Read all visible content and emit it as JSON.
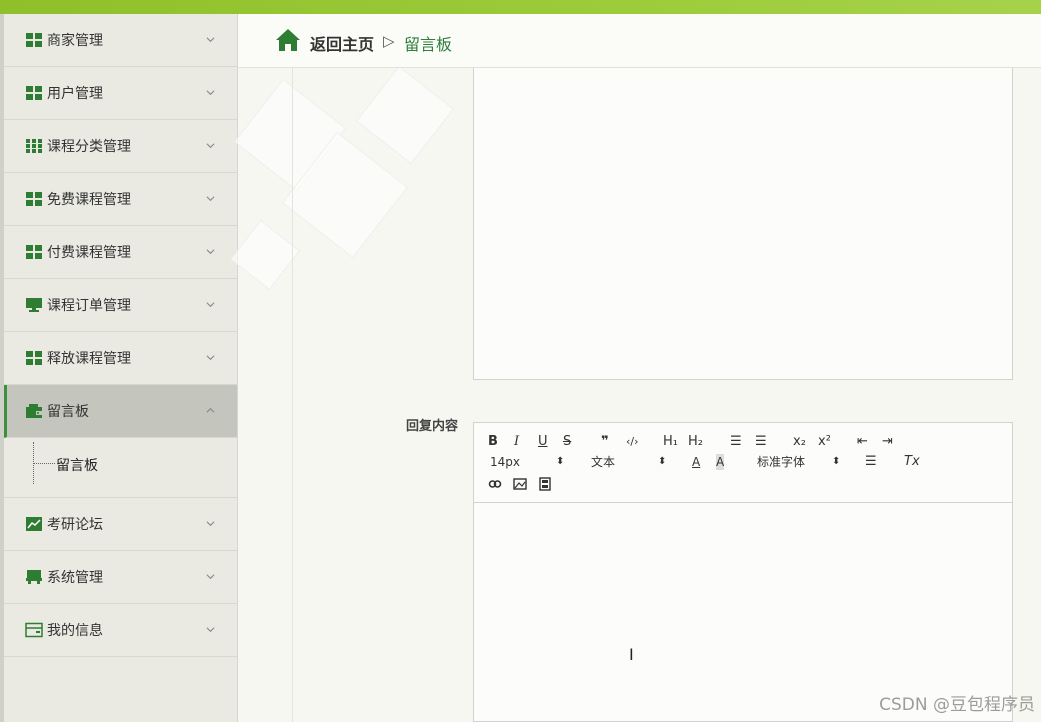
{
  "sidebar": {
    "items": [
      {
        "label": "商家管理",
        "icon": "grid-icon"
      },
      {
        "label": "用户管理",
        "icon": "grid-icon"
      },
      {
        "label": "课程分类管理",
        "icon": "grid9-icon"
      },
      {
        "label": "免费课程管理",
        "icon": "grid-icon"
      },
      {
        "label": "付费课程管理",
        "icon": "grid-icon"
      },
      {
        "label": "课程订单管理",
        "icon": "monitor-icon"
      },
      {
        "label": "释放课程管理",
        "icon": "grid-icon"
      },
      {
        "label": "留言板",
        "icon": "wallet-icon",
        "expanded": true,
        "children": [
          "留言板"
        ]
      },
      {
        "label": "考研论坛",
        "icon": "chart-icon"
      },
      {
        "label": "系统管理",
        "icon": "store-icon"
      },
      {
        "label": "我的信息",
        "icon": "card-icon"
      }
    ]
  },
  "header": {
    "home": "返回主页",
    "sep": "▷",
    "current": "留言板"
  },
  "form": {
    "reply_label": "回复内容"
  },
  "toolbar": {
    "bold": "B",
    "italic": "I",
    "underline": "U",
    "strike": "S",
    "quote": "❞",
    "code": "‹/›",
    "h1": "H₁",
    "h2": "H₂",
    "ol": "☰",
    "ul": "☰",
    "sub": "x₂",
    "sup": "x²",
    "outdent": "⇤",
    "indent": "⇥",
    "size": "14px",
    "size_caret": "⬍",
    "style": "文本",
    "style_caret": "⬍",
    "color": "A",
    "bg": "A",
    "font": "标准字体",
    "font_caret": "⬍",
    "align": "☰",
    "clean": "Tx"
  },
  "watermark": "CSDN @豆包程序员",
  "colors": {
    "accent": "#2f7e3c",
    "top": "#9ccc3a",
    "icon": "#2e7d32"
  }
}
